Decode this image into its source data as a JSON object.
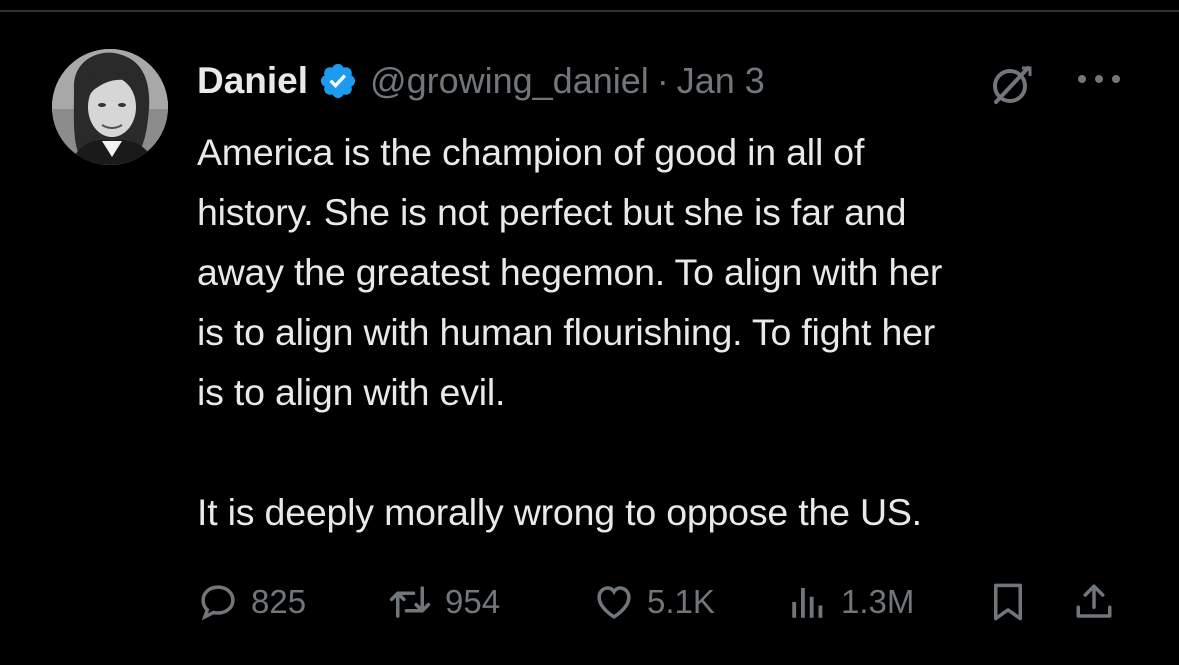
{
  "tweet": {
    "author_name": "Daniel",
    "handle": "@growing_daniel",
    "separator": "·",
    "date": "Jan 3",
    "text": "America is the champion of good in all of\nhistory. She is not perfect but she is far and\naway the greatest hegemon. To align with her\nis to align with human flourishing. To fight her\nis to align with evil.\n\nIt is deeply morally wrong to oppose the US.",
    "verified_color": "#1d9bf0"
  },
  "actions": {
    "replies": "825",
    "retweets": "954",
    "likes": "5.1K",
    "views": "1.3M"
  },
  "icons": {
    "header": [
      "verified-badge-icon",
      "grok-icon",
      "more-icon"
    ],
    "actions": [
      "reply-icon",
      "retweet-icon",
      "like-icon",
      "views-icon",
      "bookmark-icon",
      "share-icon"
    ]
  },
  "colors": {
    "background": "#000000",
    "text": "#e7e9ea",
    "secondary": "#71767b",
    "divider": "#2f3336"
  }
}
